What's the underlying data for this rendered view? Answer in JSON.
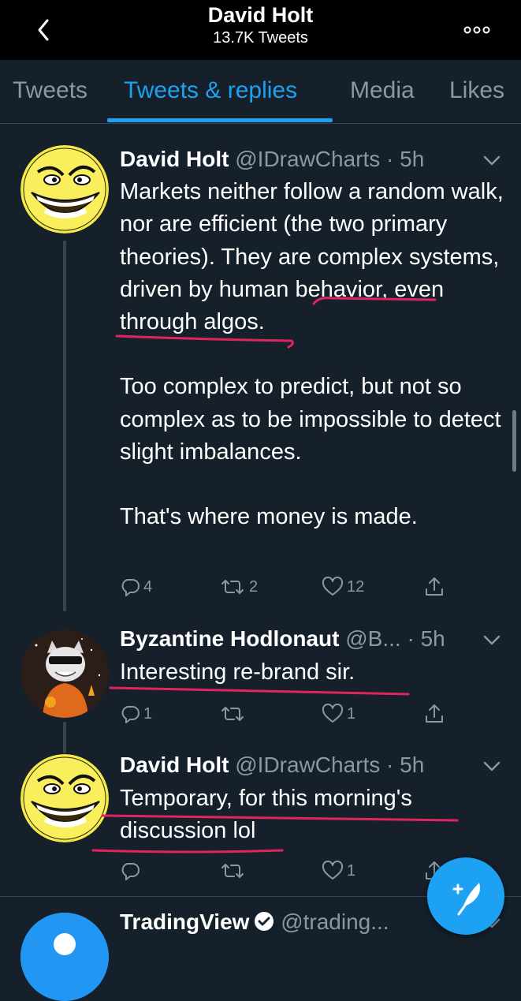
{
  "header": {
    "title": "David Holt",
    "subtitle": "13.7K Tweets"
  },
  "tabs": [
    {
      "label": "Tweets",
      "active": false
    },
    {
      "label": "Tweets & replies",
      "active": true
    },
    {
      "label": "Media",
      "active": false
    },
    {
      "label": "Likes",
      "active": false
    }
  ],
  "tweets": [
    {
      "name": "David Holt",
      "handle": "@IDrawCharts",
      "separator": "·",
      "time": "5h",
      "paragraphs": [
        "Markets neither follow a random walk, nor are efficient (the two primary theories). They are complex systems, driven by human behavior, even through algos.",
        "Too complex to predict, but not so complex as to be impossible to detect slight imbalances.",
        "That's where money is made."
      ],
      "replies": "4",
      "retweets": "2",
      "likes": "12"
    },
    {
      "name": "Byzantine Hodlonaut",
      "handle": "@B...",
      "separator": "·",
      "time": "5h",
      "paragraphs": [
        "Interesting re-brand sir."
      ],
      "replies": "1",
      "retweets": "",
      "likes": "1"
    },
    {
      "name": "David Holt",
      "handle": "@IDrawCharts",
      "separator": "·",
      "time": "5h",
      "paragraphs": [
        "Temporary, for this morning's discussion lol"
      ],
      "replies": "",
      "retweets": "",
      "likes": "1"
    },
    {
      "name": "TradingView",
      "handle": "@trading...",
      "verified": true
    }
  ],
  "colors": {
    "background": "#15202b",
    "header": "#000000",
    "accent": "#1da1f2",
    "muted": "#8899a6",
    "annotation_red": "#e0245e"
  },
  "icons": [
    "back-arrow-icon",
    "more-icon",
    "reply-icon",
    "retweet-icon",
    "like-icon",
    "share-icon",
    "caret-down-icon",
    "compose-icon",
    "verified-icon"
  ]
}
